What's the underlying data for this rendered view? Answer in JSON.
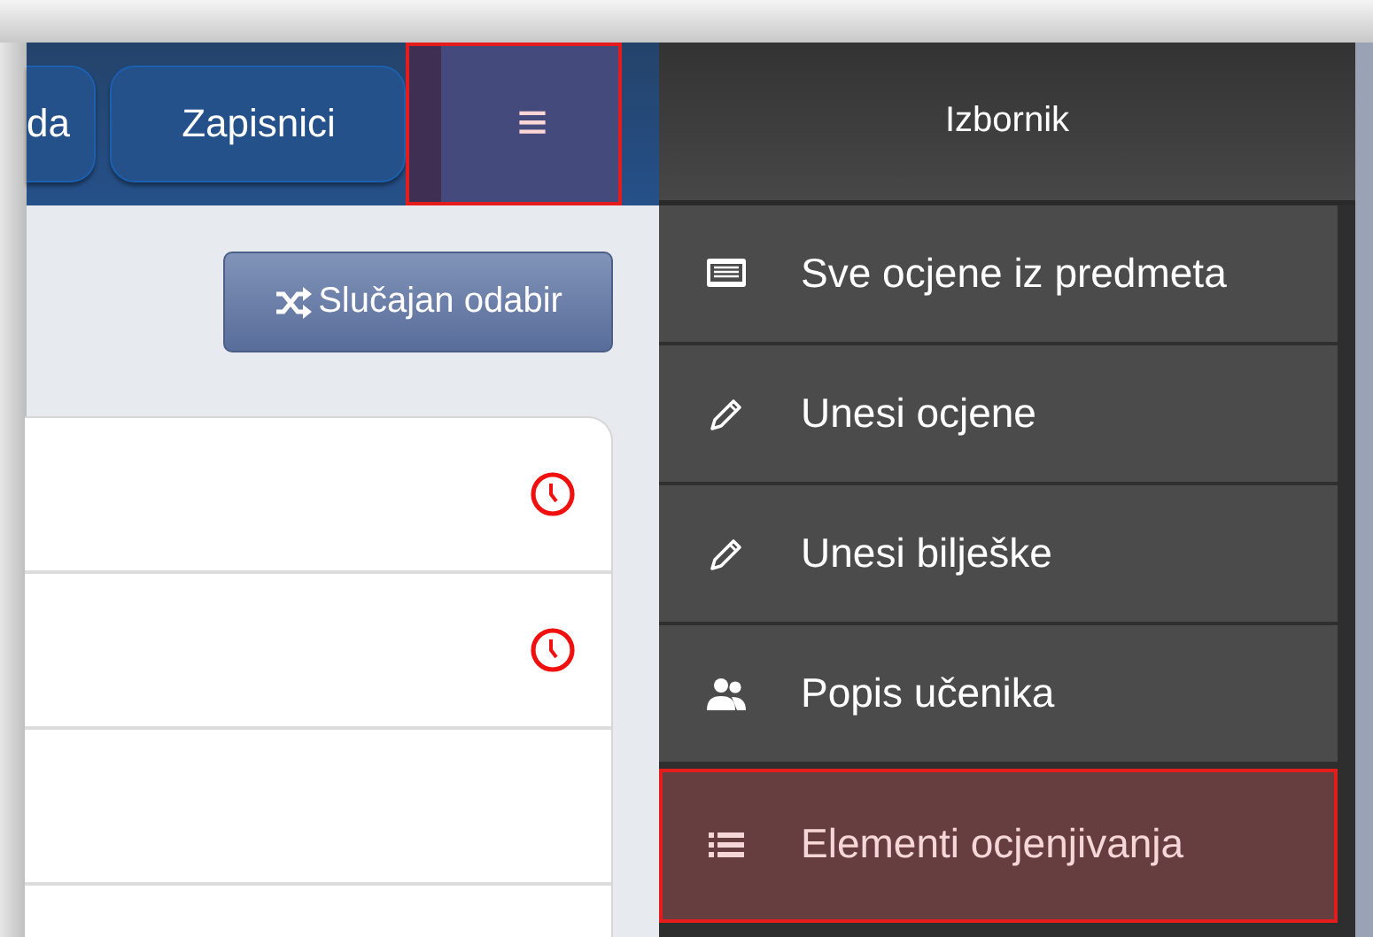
{
  "toolbar": {
    "buttons": [
      {
        "label": "da"
      },
      {
        "label": "Zapisnici"
      }
    ],
    "menu_button": {
      "label": "≡",
      "highlighted": true
    }
  },
  "random_button": {
    "label": "Slučajan odabir"
  },
  "rows": [
    {
      "kind": "clock"
    },
    {
      "kind": "clock"
    },
    {
      "kind": "empty"
    },
    {
      "kind": "empty"
    }
  ],
  "menu": {
    "title": "Izbornik",
    "items": [
      {
        "label": "Sve ocjene iz predmeta",
        "kind": "card",
        "highlighted": false
      },
      {
        "label": "Unesi ocjene",
        "kind": "pencil",
        "highlighted": false
      },
      {
        "label": "Unesi bilješke",
        "kind": "pencil",
        "highlighted": false
      },
      {
        "label": "Popis učenika",
        "kind": "users",
        "highlighted": false
      },
      {
        "label": "Elementi ocjenjivanja",
        "kind": "list",
        "highlighted": true
      }
    ]
  }
}
